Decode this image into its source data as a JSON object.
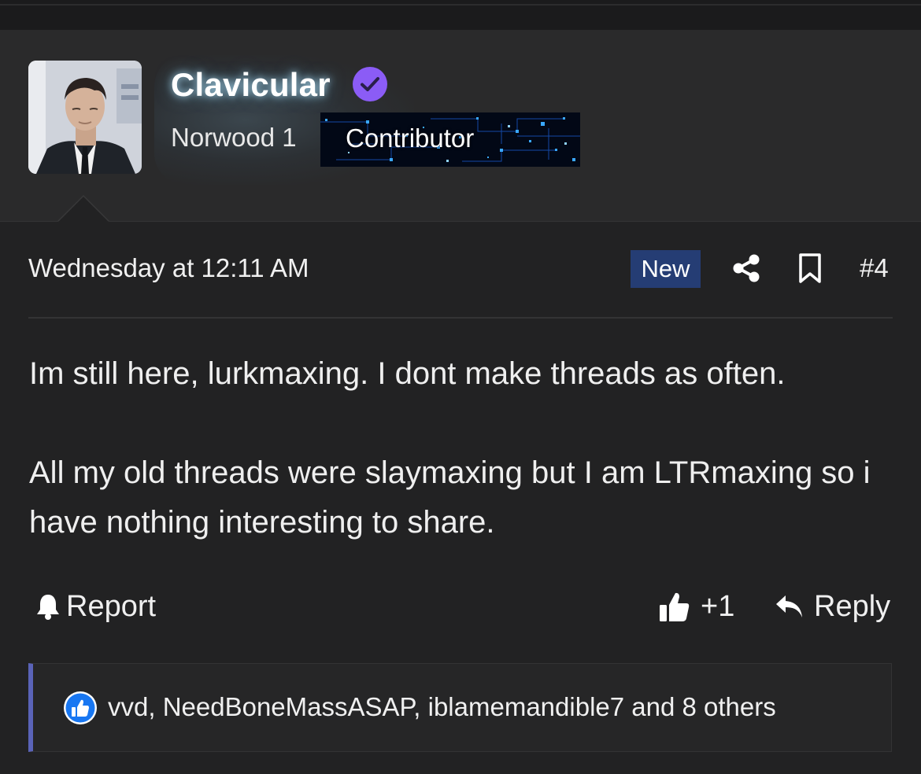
{
  "author": {
    "username": "Clavicular",
    "verified_icon": "verified-check-icon",
    "title": "Norwood 1",
    "banner": "Contributor",
    "accent_color": "#8b5cf6"
  },
  "post": {
    "date": "Wednesday at 12:11 AM",
    "new_badge": "New",
    "number": "#4",
    "paragraphs": [
      "Im still here, lurkmaxing. I dont make threads as often.",
      "All my old threads were slaymaxing but I am LTRmaxing so i have nothing interesting to share."
    ]
  },
  "actions": {
    "report": "Report",
    "like_count": "+1",
    "reply": "Reply"
  },
  "reactions": {
    "summary": "vvd, NeedBoneMassASAP, iblamemandible7 and 8 others",
    "icon": "thumbs-up-icon",
    "bar_color": "#5a63b8"
  },
  "colors": {
    "background": "#222223",
    "new_badge": "#253d74",
    "reaction_blue": "#1877f2"
  }
}
